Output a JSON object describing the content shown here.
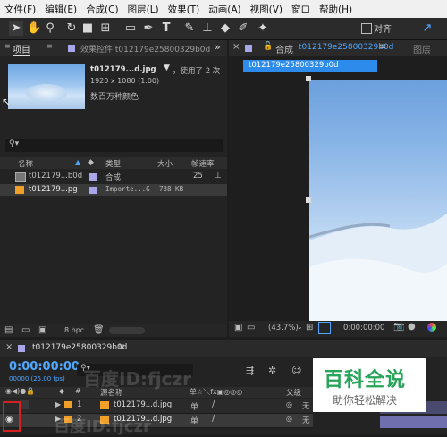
{
  "menu": [
    "文件(F)",
    "编辑(E)",
    "合成(C)",
    "图层(L)",
    "效果(T)",
    "动画(A)",
    "视图(V)",
    "窗口",
    "帮助(H)"
  ],
  "toolbar": {
    "align_label": "对齐"
  },
  "project_panel": {
    "tab_project": "项目",
    "tab_effects": "效果控件 t012179e25800329b0d",
    "file_name": "t012179...d.jpg",
    "file_usage": "，使用了 2 次",
    "file_dims": "1920 x 1080 (1.00)",
    "file_color": "数百万种颜色",
    "search_placeholder": "",
    "columns": {
      "name": "名称",
      "type": "类型",
      "size": "大小",
      "fps": "帧速率"
    },
    "items": [
      {
        "name": "t012179...b0d",
        "type": "合成",
        "size": "",
        "fps": "25"
      },
      {
        "name": "t012179...pg",
        "type": "Importe...G",
        "size": "738 KB",
        "fps": ""
      }
    ],
    "bpc": "8 bpc"
  },
  "comp_panel": {
    "tab_label": "合成",
    "tab_name": "t012179e25800329b0d",
    "layer_tab": "图层",
    "breadcrumb": "t012179e25800329b0d",
    "zoom": "(43.7%)",
    "timecode": "0:00:00:00"
  },
  "timeline": {
    "comp_name": "t012179e25800329b0d",
    "timecode": "0:00:00:00",
    "fps_info": "00000 (25.00 fps)",
    "col_source": "源名称",
    "col_switches": "单☆＼fx▣◎◎◎",
    "col_parent": "父级",
    "layers": [
      {
        "num": "1",
        "name": "t012179...d.jpg",
        "parent": "无"
      },
      {
        "num": "2",
        "name": "t012179...d.jpg",
        "parent": "无"
      }
    ]
  },
  "overlay": {
    "brand": "百科全说",
    "tagline": "助你轻松解决",
    "watermark1": "百度ID:fjczr",
    "watermark2": "百度ID:fjczr"
  },
  "colors": {
    "accent": "#2d8ceb",
    "label_violet": "#a8a6e8",
    "label_orange": "#f0a028",
    "highlight_red": "#d42020"
  }
}
